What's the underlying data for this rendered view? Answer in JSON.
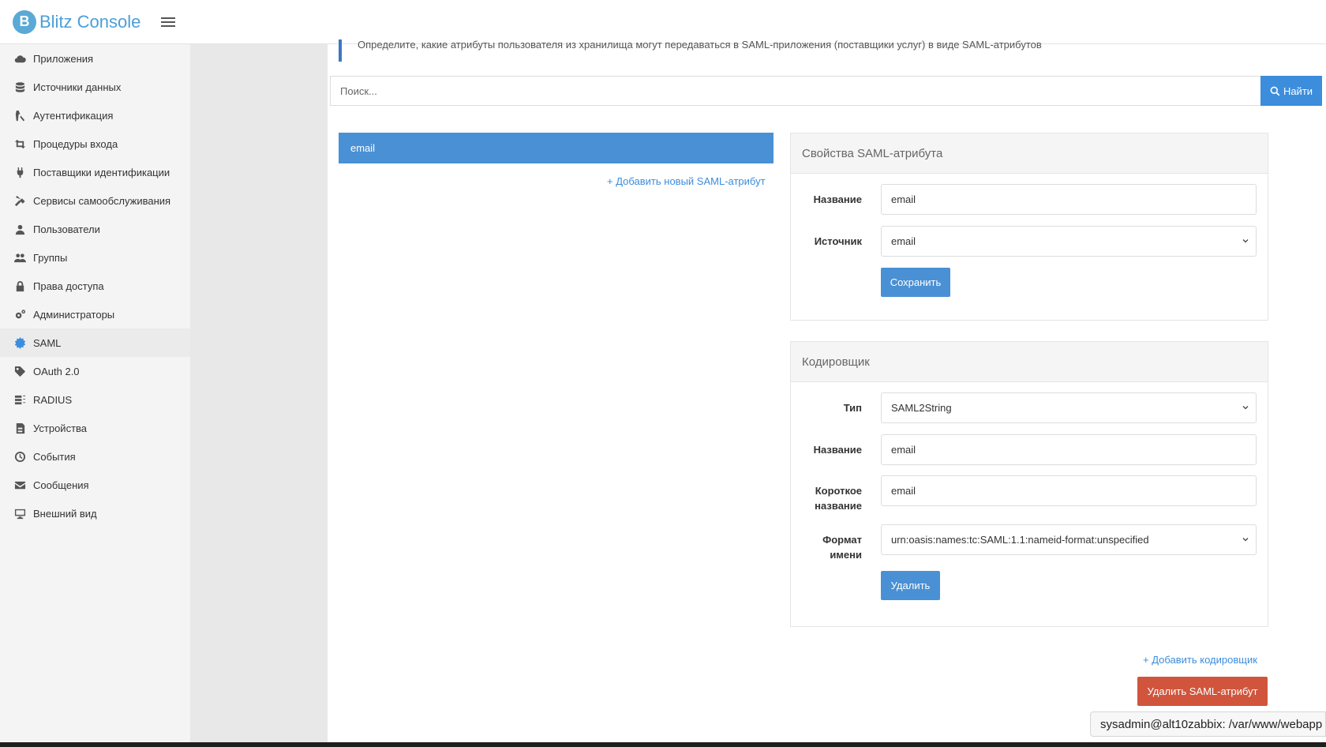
{
  "app": {
    "title": "Blitz Console",
    "logo_letter": "B",
    "accent": "#4a9fd8"
  },
  "sidebar": {
    "items": [
      {
        "label": "Приложения",
        "icon": "cloud-icon"
      },
      {
        "label": "Источники данных",
        "icon": "database-icon"
      },
      {
        "label": "Аутентификация",
        "icon": "key-icon"
      },
      {
        "label": "Процедуры входа",
        "icon": "retweet-icon"
      },
      {
        "label": "Поставщики идентификации",
        "icon": "plug-icon"
      },
      {
        "label": "Сервисы самообслуживания",
        "icon": "tools-icon"
      },
      {
        "label": "Пользователи",
        "icon": "user-icon"
      },
      {
        "label": "Группы",
        "icon": "users-icon"
      },
      {
        "label": "Права доступа",
        "icon": "lock-icon"
      },
      {
        "label": "Администраторы",
        "icon": "cogs-icon"
      },
      {
        "label": "SAML",
        "icon": "certificate-icon"
      },
      {
        "label": "OAuth 2.0",
        "icon": "tag-icon"
      },
      {
        "label": "RADIUS",
        "icon": "server-icon"
      },
      {
        "label": "Устройства",
        "icon": "device-icon"
      },
      {
        "label": "События",
        "icon": "clock-icon"
      },
      {
        "label": "Сообщения",
        "icon": "envelope-icon"
      },
      {
        "label": "Внешний вид",
        "icon": "monitor-icon"
      }
    ],
    "active": "SAML"
  },
  "main": {
    "notice": "Определите, какие атрибуты пользователя из хранилища могут передаваться в SAML-приложения (поставщики услуг) в виде SAML-атрибутов",
    "search": {
      "placeholder": "Поиск...",
      "button": "Найти"
    },
    "attributes": [
      "email"
    ],
    "add_attribute": "+ Добавить новый SAML-атрибут",
    "properties_panel": {
      "title": "Свойства SAML-атрибута",
      "name_label": "Название",
      "name_value": "email",
      "source_label": "Источник",
      "source_value": "email",
      "save": "Сохранить"
    },
    "encoder_panel": {
      "title": "Кодировщик",
      "type_label": "Тип",
      "type_value": "SAML2String",
      "name_label": "Название",
      "name_value": "email",
      "short_label": "Короткое название",
      "short_value": "email",
      "format_label": "Формат имени",
      "format_value": "urn:oasis:names:tc:SAML:1.1:nameid-format:unspecified",
      "delete": "Удалить"
    },
    "add_encoder": "+ Добавить кодировщик",
    "delete_attribute": "Удалить SAML-атрибут"
  },
  "terminal": {
    "text": "sysadmin@alt10zabbix: /var/www/webapp"
  }
}
